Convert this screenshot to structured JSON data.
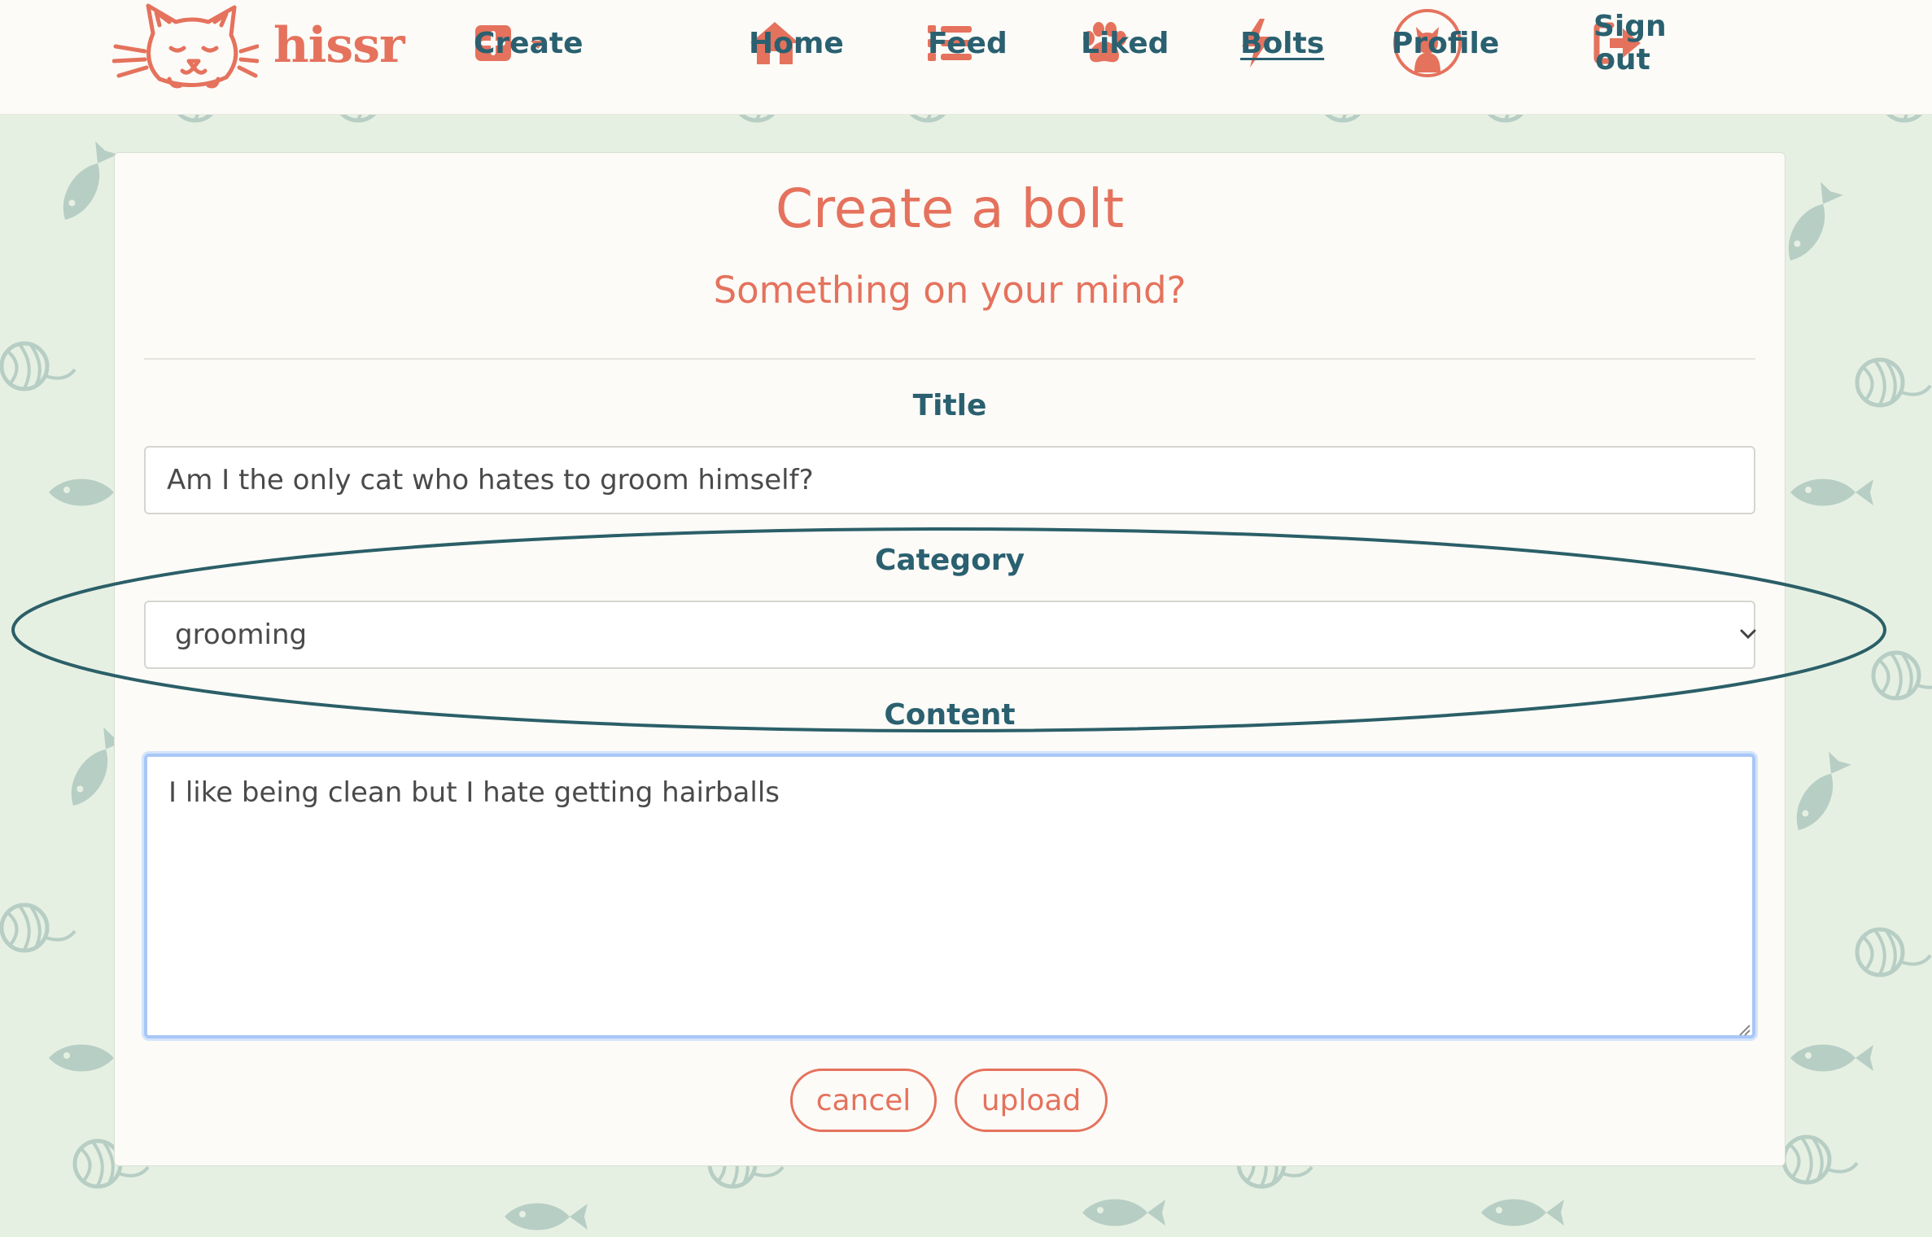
{
  "colors": {
    "brand": "#e5725d",
    "label_teal": "#2a6070",
    "page_bg": "#e6f0e2",
    "pattern": "#b7cec5",
    "annotation": "#2b5f68"
  },
  "brand": {
    "name": "hissr",
    "logo_icon": "cat-face-logo"
  },
  "nav": {
    "create": {
      "label": "Create",
      "icon": "plus-square-icon"
    },
    "home": {
      "label": "Home",
      "icon": "house-icon"
    },
    "feed": {
      "label": "Feed",
      "icon": "list-icon"
    },
    "liked": {
      "label": "Liked",
      "icon": "paw-icon"
    },
    "bolts": {
      "label": "Bolts",
      "icon": "bolt-icon",
      "active": true
    },
    "profile": {
      "label": "Profile",
      "icon": "cat-avatar-icon"
    },
    "signout": {
      "label": "Sign out",
      "icon": "sign-out-icon"
    }
  },
  "form": {
    "title": "Create a bolt",
    "subtitle": "Something on your mind?",
    "title_label": "Title",
    "title_value": "Am I the only cat who hates to groom himself?",
    "category_label": "Category",
    "category_value": "grooming",
    "content_label": "Content",
    "content_value": "I like being clean but I hate getting hairballs",
    "cancel_label": "cancel",
    "upload_label": "upload"
  }
}
